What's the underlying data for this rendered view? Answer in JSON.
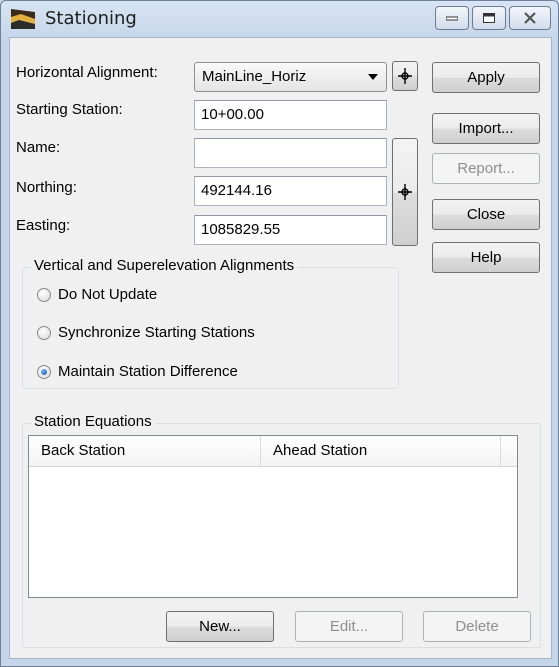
{
  "window": {
    "title": "Stationing",
    "app_icon": "stationing-app-icon"
  },
  "title_buttons": {
    "minimize": "minimize-icon",
    "maximize": "maximize-icon",
    "close": "close-icon"
  },
  "form": {
    "horizontal_alignment_label": "Horizontal Alignment:",
    "horizontal_alignment_value": "MainLine_Horiz",
    "starting_station_label": "Starting Station:",
    "starting_station_value": "10+00.00",
    "name_label": "Name:",
    "name_value": "",
    "northing_label": "Northing:",
    "northing_value": "492144.16",
    "easting_label": "Easting:",
    "easting_value": "1085829.55"
  },
  "buttons": {
    "apply": "Apply",
    "import": "Import...",
    "report": "Report...",
    "close": "Close",
    "help": "Help"
  },
  "vertical_group": {
    "title": "Vertical and Superelevation Alignments",
    "options": [
      {
        "label": "Do Not Update",
        "checked": false
      },
      {
        "label": "Synchronize Starting Stations",
        "checked": false
      },
      {
        "label": "Maintain Station Difference",
        "checked": true
      }
    ]
  },
  "equations_group": {
    "title": "Station Equations",
    "columns": [
      "Back Station",
      "Ahead Station"
    ],
    "rows": [],
    "new_label": "New...",
    "edit_label": "Edit...",
    "delete_label": "Delete"
  },
  "colors": {
    "accent": "#1a4f9e",
    "disabled_text": "#8f8f8f"
  }
}
